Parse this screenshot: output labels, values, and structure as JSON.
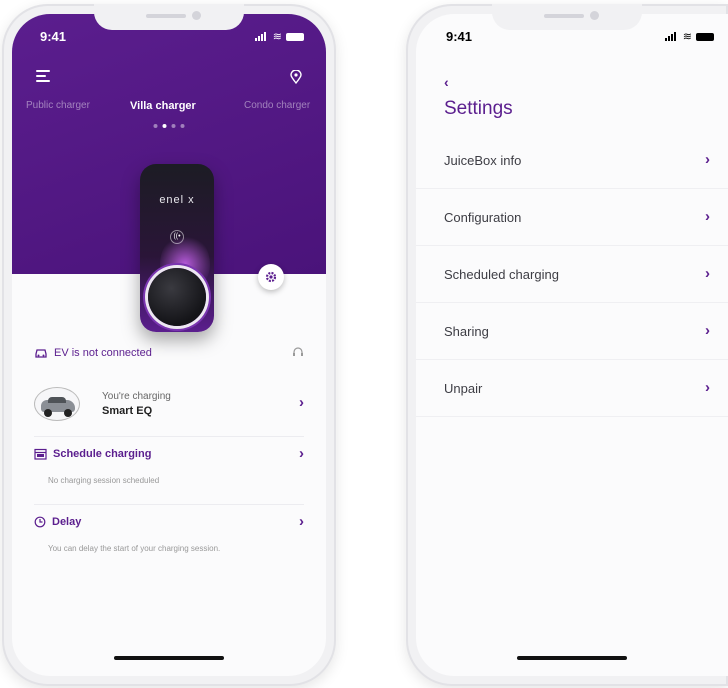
{
  "left": {
    "status": {
      "time": "9:41"
    },
    "header": {
      "tabs": [
        "Public charger",
        "Villa charger",
        "Condo charger"
      ],
      "active_tab": 1,
      "page_dots": 4,
      "active_dot": 1
    },
    "charger": {
      "brand": "enel x",
      "badge": "((•"
    },
    "connection": {
      "label": "EV is not connected"
    },
    "vehicle": {
      "status": "You're charging",
      "name": "Smart EQ"
    },
    "schedule": {
      "title": "Schedule charging",
      "desc": "No charging session scheduled"
    },
    "delay": {
      "title": "Delay",
      "desc": "You can delay the start of your charging session."
    }
  },
  "right": {
    "status": {
      "time": "9:41"
    },
    "title": "Settings",
    "items": [
      {
        "label": "JuiceBox info"
      },
      {
        "label": "Configuration"
      },
      {
        "label": "Scheduled charging"
      },
      {
        "label": "Sharing"
      },
      {
        "label": "Unpair"
      }
    ]
  },
  "colors": {
    "accent": "#5b1e8e",
    "header_bg": "#4f1682"
  },
  "icons": [
    "menu-icon",
    "location-pin-icon",
    "gear-icon",
    "car-icon",
    "headset-icon",
    "calendar-icon",
    "clock-icon",
    "chevron-right-icon",
    "chevron-left-icon"
  ]
}
